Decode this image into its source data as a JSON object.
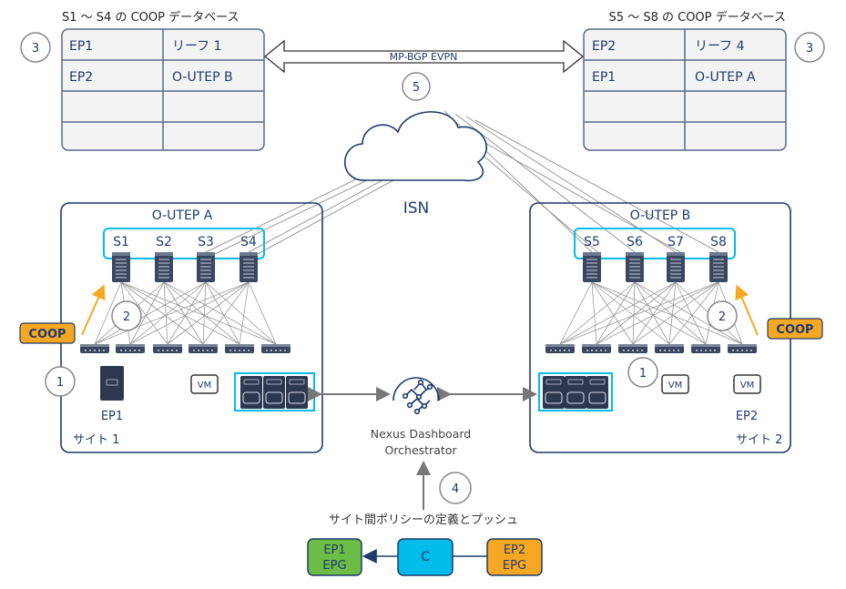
{
  "left_db": {
    "title": "S1 ～ S4 の COOP データベース",
    "step": "3",
    "rows": [
      [
        "EP1",
        "リーフ 1"
      ],
      [
        "EP2",
        "O-UTEP B"
      ],
      [
        "",
        ""
      ],
      [
        "",
        ""
      ]
    ]
  },
  "right_db": {
    "title": "S5 ～ S8 の COOP データベース",
    "step": "3",
    "rows": [
      [
        "EP2",
        "リーフ 4"
      ],
      [
        "EP1",
        "O-UTEP A"
      ],
      [
        "",
        ""
      ],
      [
        "",
        ""
      ]
    ]
  },
  "evpn": {
    "label": "MP-BGP EVPN",
    "step": "5"
  },
  "isn": {
    "label": "ISN"
  },
  "site1": {
    "label": "サイト 1",
    "utep": "O-UTEP A",
    "spines": [
      "S1",
      "S2",
      "S3",
      "S4"
    ],
    "coop": "COOP",
    "step_coop": "2",
    "step_ep": "1",
    "endpoint": "EP1",
    "vm": "VM"
  },
  "site2": {
    "label": "サイト 2",
    "utep": "O-UTEP B",
    "spines": [
      "S5",
      "S6",
      "S7",
      "S8"
    ],
    "coop": "COOP",
    "step_coop": "2",
    "step_ep": "1",
    "endpoint": "EP2",
    "vm1": "VM",
    "vm2": "VM"
  },
  "ndo": {
    "line1": "Nexus Dashboard",
    "line2": "Orchestrator",
    "step": "4"
  },
  "policy": {
    "caption": "サイト間ポリシーの定義とプッシュ",
    "epg1": [
      "EP1",
      "EPG"
    ],
    "contract": "C",
    "epg2": [
      "EP2",
      "EPG"
    ]
  },
  "colors": {
    "navy": "#1f3a6b",
    "cyan": "#00bceb",
    "orange": "#f7a823",
    "green": "#6cbd45",
    "gray": "#888888"
  }
}
